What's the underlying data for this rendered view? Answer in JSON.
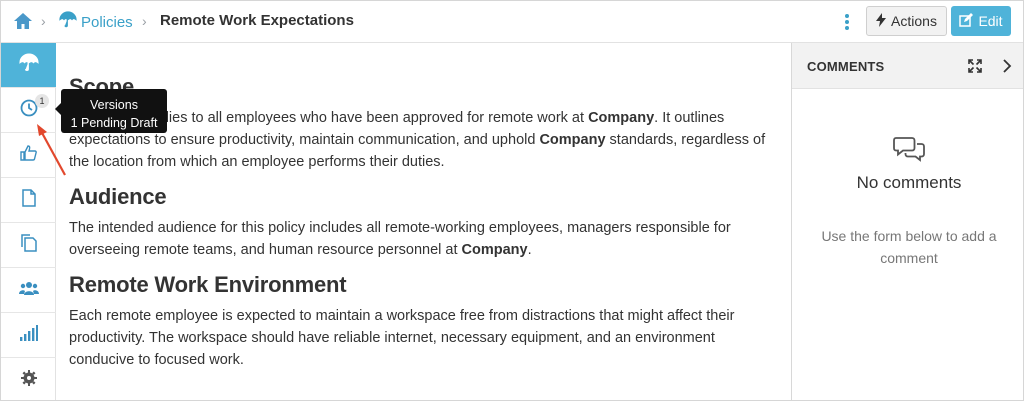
{
  "breadcrumb": {
    "home_icon": "home-icon",
    "separator": "›",
    "policies_label": "Policies",
    "policies_icon": "umbrella-icon",
    "current_title": "Remote Work Expectations"
  },
  "toolbar": {
    "more_icon": "vertical-ellipsis-icon",
    "actions_label": "Actions",
    "actions_icon": "bolt-icon",
    "edit_label": "Edit",
    "edit_icon": "pencil-square-icon"
  },
  "rail": {
    "items": [
      {
        "icon": "umbrella-icon",
        "active": true
      },
      {
        "icon": "clock-icon",
        "badge": "1"
      },
      {
        "icon": "thumbs-up-icon"
      },
      {
        "icon": "document-icon"
      },
      {
        "icon": "copy-icon"
      },
      {
        "icon": "users-icon"
      },
      {
        "icon": "signal-bars-icon"
      },
      {
        "icon": "gear-icon"
      }
    ]
  },
  "tooltip": {
    "line1": "Versions",
    "line2": "1 Pending Draft"
  },
  "content": {
    "sections": [
      {
        "heading": "Scope",
        "text_parts": [
          "This policy applies to all employees who have been approved for remote work at ",
          "Company",
          ". It outlines expectations to ensure productivity, maintain communication, and uphold ",
          "Company",
          " standards, regardless of the location from which an employee performs their duties."
        ]
      },
      {
        "heading": "Audience",
        "text_parts": [
          "The intended audience for this policy includes all remote-working employees, managers responsible for overseeing remote teams, and human resource personnel at ",
          "Company",
          "."
        ]
      },
      {
        "heading": "Remote Work Environment",
        "text_parts": [
          "Each remote employee is expected to maintain a workspace free from distractions that might affect their productivity. The workspace should have reliable internet, necessary equipment, and an environment conducive to focused work."
        ]
      }
    ]
  },
  "comments": {
    "title": "COMMENTS",
    "expand_icon": "expand-icon",
    "collapse_icon": "chevron-right-icon",
    "empty_icon": "chat-bubbles-icon",
    "empty_title": "No comments",
    "empty_help": "Use the form below to add a comment"
  },
  "colors": {
    "accent": "#4fb3d9",
    "link": "#3aa0c8",
    "annotation_arrow": "#e2482d"
  }
}
